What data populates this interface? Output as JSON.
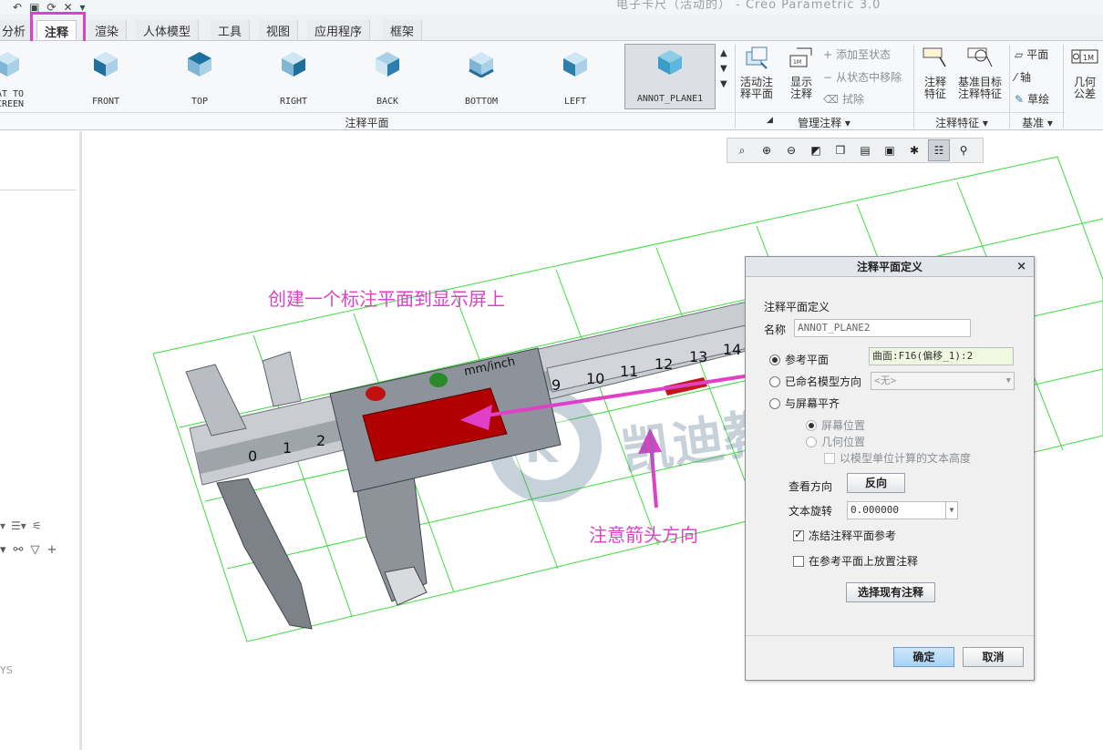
{
  "window_title": "电子卡尺（活动的） - Creo Parametric 3.0",
  "tabs": [
    {
      "label": "分析",
      "active": false
    },
    {
      "label": "注释",
      "active": true
    },
    {
      "label": "渲染",
      "active": false
    },
    {
      "label": "人体模型",
      "active": false
    },
    {
      "label": "工具",
      "active": false
    },
    {
      "label": "视图",
      "active": false
    },
    {
      "label": "应用程序",
      "active": false
    },
    {
      "label": "框架",
      "active": false
    }
  ],
  "ribbon": {
    "views": [
      {
        "label": "LAT TO\nSCREEN",
        "icon": "flat-to-screen-cube-icon"
      },
      {
        "label": "FRONT",
        "icon": "front-view-cube-icon"
      },
      {
        "label": "TOP",
        "icon": "top-view-cube-icon"
      },
      {
        "label": "RIGHT",
        "icon": "right-view-cube-icon"
      },
      {
        "label": "BACK",
        "icon": "back-view-cube-icon"
      },
      {
        "label": "BOTTOM",
        "icon": "bottom-view-cube-icon"
      },
      {
        "label": "LEFT",
        "icon": "left-view-cube-icon"
      },
      {
        "label": "ANNOT_PLANE1",
        "icon": "annot-plane-cube-icon"
      }
    ],
    "group_annot_plane": "注释平面",
    "activate_plane": "活动注\n释平面",
    "show_annotation": "显示\n注释",
    "add_to_state": "添加至状态",
    "remove_from_state": "从状态中移除",
    "erase": "拭除",
    "group_manage": "管理注释",
    "annot_feature": "注释\n特征",
    "datum_target": "基准目标\n注释特征",
    "group_annot_feature": "注释特征",
    "plane": "平面",
    "axis": "轴",
    "sketch": "草绘",
    "group_datum": "基准",
    "geom_tol": "几何\n公差"
  },
  "left_panel": {
    "bottom_text": "YS"
  },
  "annotations": {
    "create_plane": "创建一个标注平面到显示屏上",
    "note_arrow": "注意箭头方向"
  },
  "watermark": "凯迪教育",
  "caliper": {
    "unit_label": "mm/inch",
    "main_scale": [
      "0",
      "1",
      "2"
    ],
    "beam_scale": [
      "9",
      "10",
      "11",
      "12",
      "13",
      "14"
    ]
  },
  "dialog": {
    "title": "注释平面定义",
    "section": "注释平面定义",
    "name_label": "名称",
    "name_value": "ANNOT_PLANE2",
    "ref_plane_label": "参考平面",
    "ref_plane_value": "曲面:F16(偏移_1):2",
    "named_dir_label": "已命名模型方向",
    "named_dir_value": "<无>",
    "align_screen_label": "与屏幕平齐",
    "screen_pos": "屏幕位置",
    "geom_pos": "几何位置",
    "model_units": "以模型单位计算的文本高度",
    "view_dir_label": "查看方向",
    "reverse_btn": "反向",
    "rotate_label": "文本旋转",
    "rotate_value": "0.000000",
    "freeze_ref": "冻结注释平面参考",
    "place_on_ref": "在参考平面上放置注释",
    "select_existing": "选择现有注释",
    "ok": "确定",
    "cancel": "取消"
  },
  "colors": {
    "accent": "#e040c8",
    "grid": "#3ddc3d",
    "ok_button": "#a7d2f5"
  }
}
